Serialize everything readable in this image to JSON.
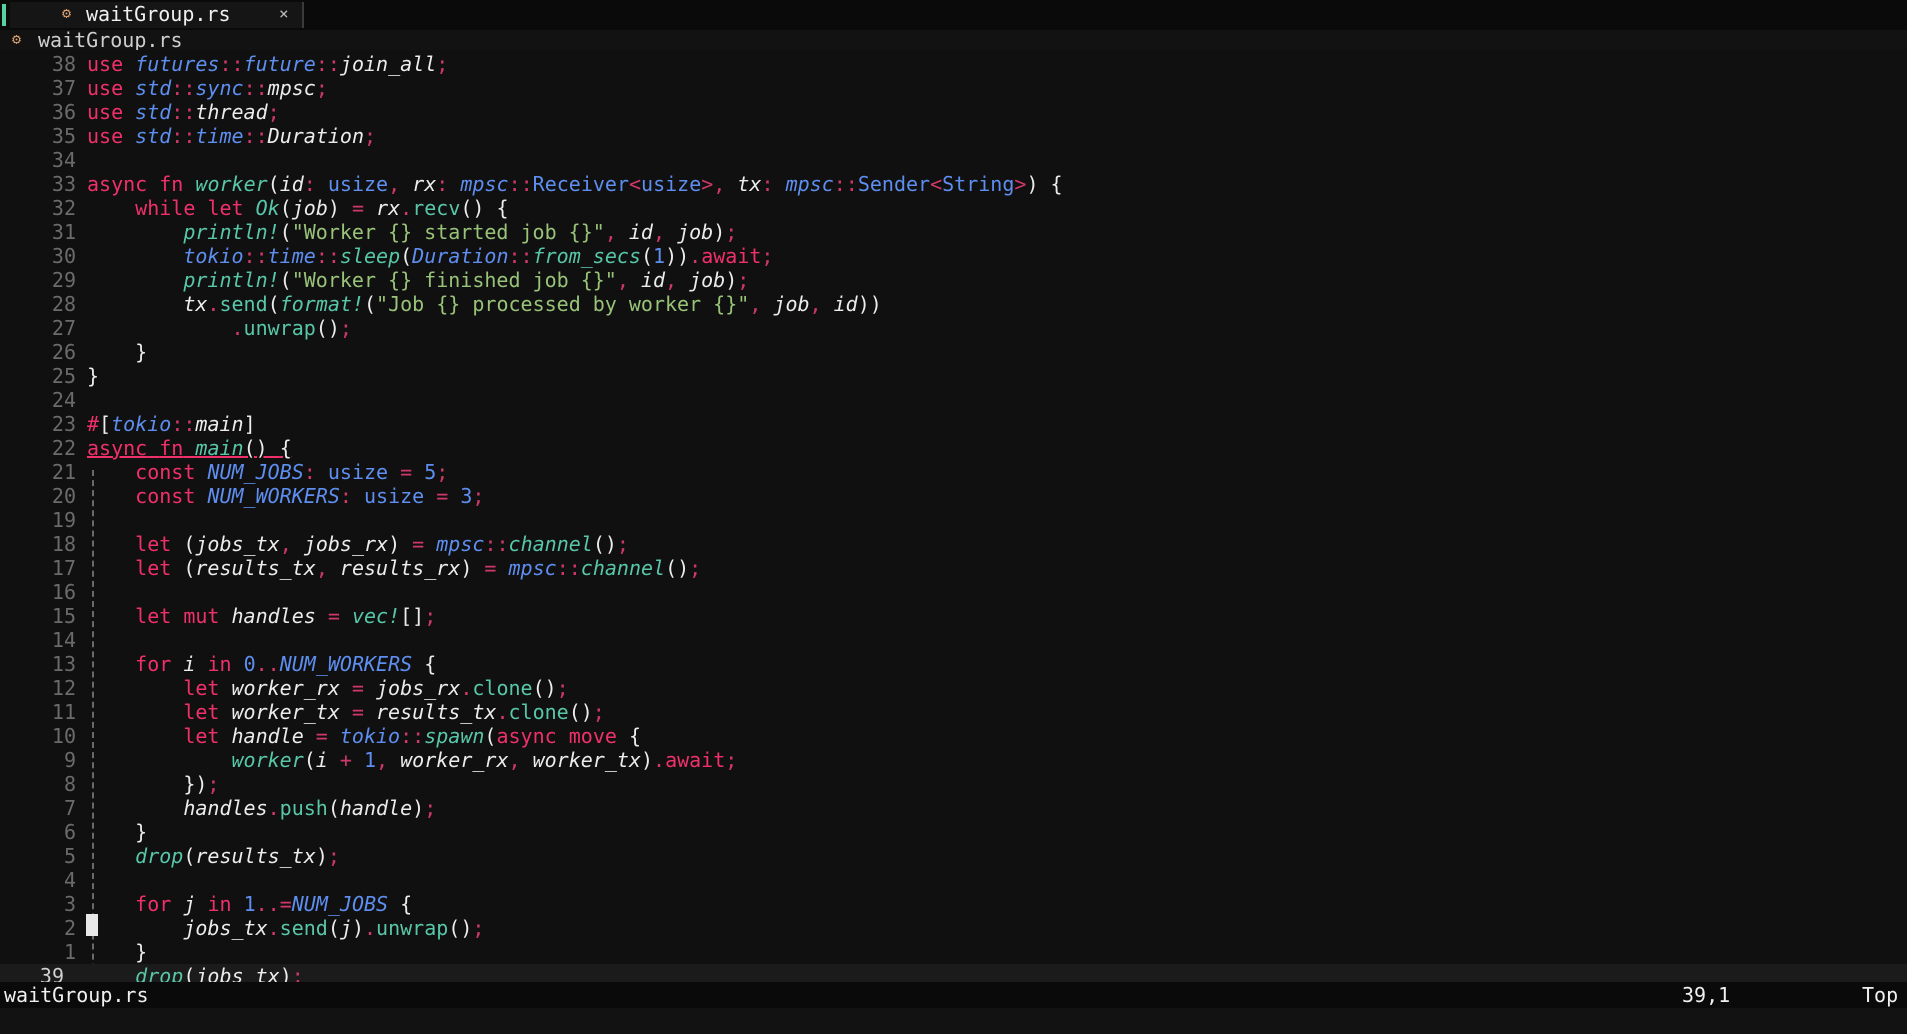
{
  "tab": {
    "icon": "rust-file-icon",
    "name": "waitGroup.rs",
    "close": "×"
  },
  "winbar": {
    "icon": "rust-file-icon",
    "name": "waitGroup.rs"
  },
  "line_numbers": [
    "38",
    "37",
    "36",
    "35",
    "34",
    "33",
    "32",
    "31",
    "30",
    "29",
    "28",
    "27",
    "26",
    "25",
    "24",
    "23",
    "22",
    "21",
    "20",
    "19",
    "18",
    "17",
    "16",
    "15",
    "14",
    "13",
    "12",
    "11",
    "10",
    "9",
    "8",
    "7",
    "6",
    "5",
    "4",
    "3",
    "2",
    "1",
    "39"
  ],
  "code_lines": [
    "use futures::future::join_all;",
    "use std::sync::mpsc;",
    "use std::thread;",
    "use std::time::Duration;",
    "",
    "async fn worker(id: usize, rx: mpsc::Receiver<usize>, tx: mpsc::Sender<String>) {",
    "    while let Ok(job) = rx.recv() {",
    "        println!(\"Worker {} started job {}\", id, job);",
    "        tokio::time::sleep(Duration::from_secs(1)).await;",
    "        println!(\"Worker {} finished job {}\", id, job);",
    "        tx.send(format!(\"Job {} processed by worker {}\", job, id))",
    "            .unwrap();",
    "    }",
    "}",
    "",
    "#[tokio::main]",
    "async fn main() {",
    "    const NUM_JOBS: usize = 5;",
    "    const NUM_WORKERS: usize = 3;",
    "",
    "    let (jobs_tx, jobs_rx) = mpsc::channel();",
    "    let (results_tx, results_rx) = mpsc::channel();",
    "",
    "    let mut handles = vec![];",
    "",
    "    for i in 0..NUM_WORKERS {",
    "        let worker_rx = jobs_rx.clone();",
    "        let worker_tx = results_tx.clone();",
    "        let handle = tokio::spawn(async move {",
    "            worker(i + 1, worker_rx, worker_tx).await;",
    "        });",
    "        handles.push(handle);",
    "    }",
    "    drop(results_tx);",
    "",
    "    for j in 1..=NUM_JOBS {",
    "        jobs_tx.send(j).unwrap();",
    "    }",
    "    drop(jobs_tx);"
  ],
  "statusline": {
    "file": "waitGroup.rs",
    "position": "39,1",
    "scroll": "Top"
  },
  "colors": {
    "keyword": "#f0306a",
    "namespace": "#5e8ef0",
    "function": "#58c7a8",
    "string": "#98c379",
    "background": "#101010"
  }
}
